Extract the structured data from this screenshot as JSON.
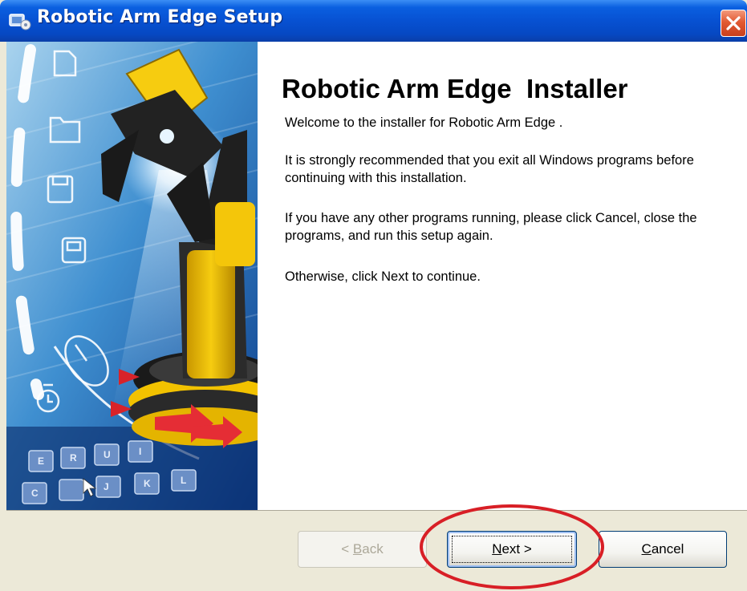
{
  "window": {
    "title": "Robotic Arm Edge Setup",
    "close_icon": "close-x-icon",
    "app_icon": "installer-icon"
  },
  "content": {
    "heading": "Robotic Arm Edge  Installer",
    "paragraphs": [
      "Welcome to the installer for Robotic Arm Edge .",
      "It is strongly recommended that you exit all Windows programs before continuing with this installation.",
      "If you have any other programs running, please click Cancel, close the programs, and run this setup again.",
      "Otherwise, click Next to continue."
    ]
  },
  "side_panel": {
    "keyboard_keys": [
      "E",
      "R",
      "U",
      "I",
      "C",
      "J",
      "K",
      "L"
    ],
    "icons": [
      "document-icon",
      "folder-icon",
      "floppy-disk-icon",
      "disk-icon",
      "mouse-icon",
      "timer-icon"
    ]
  },
  "buttons": {
    "back": {
      "prefix": "< ",
      "mnemonic": "B",
      "rest": "ack",
      "enabled": false
    },
    "next": {
      "mnemonic": "N",
      "rest": "ext >",
      "enabled": true,
      "focused": true
    },
    "cancel": {
      "mnemonic": "C",
      "rest": "ancel",
      "enabled": true
    }
  },
  "colors": {
    "titlebar": "#0751d2",
    "close_button": "#e25a33",
    "dialog_face": "#ece9d8",
    "annotation_circle": "#d81f26",
    "arm_yellow": "#f2c200"
  }
}
